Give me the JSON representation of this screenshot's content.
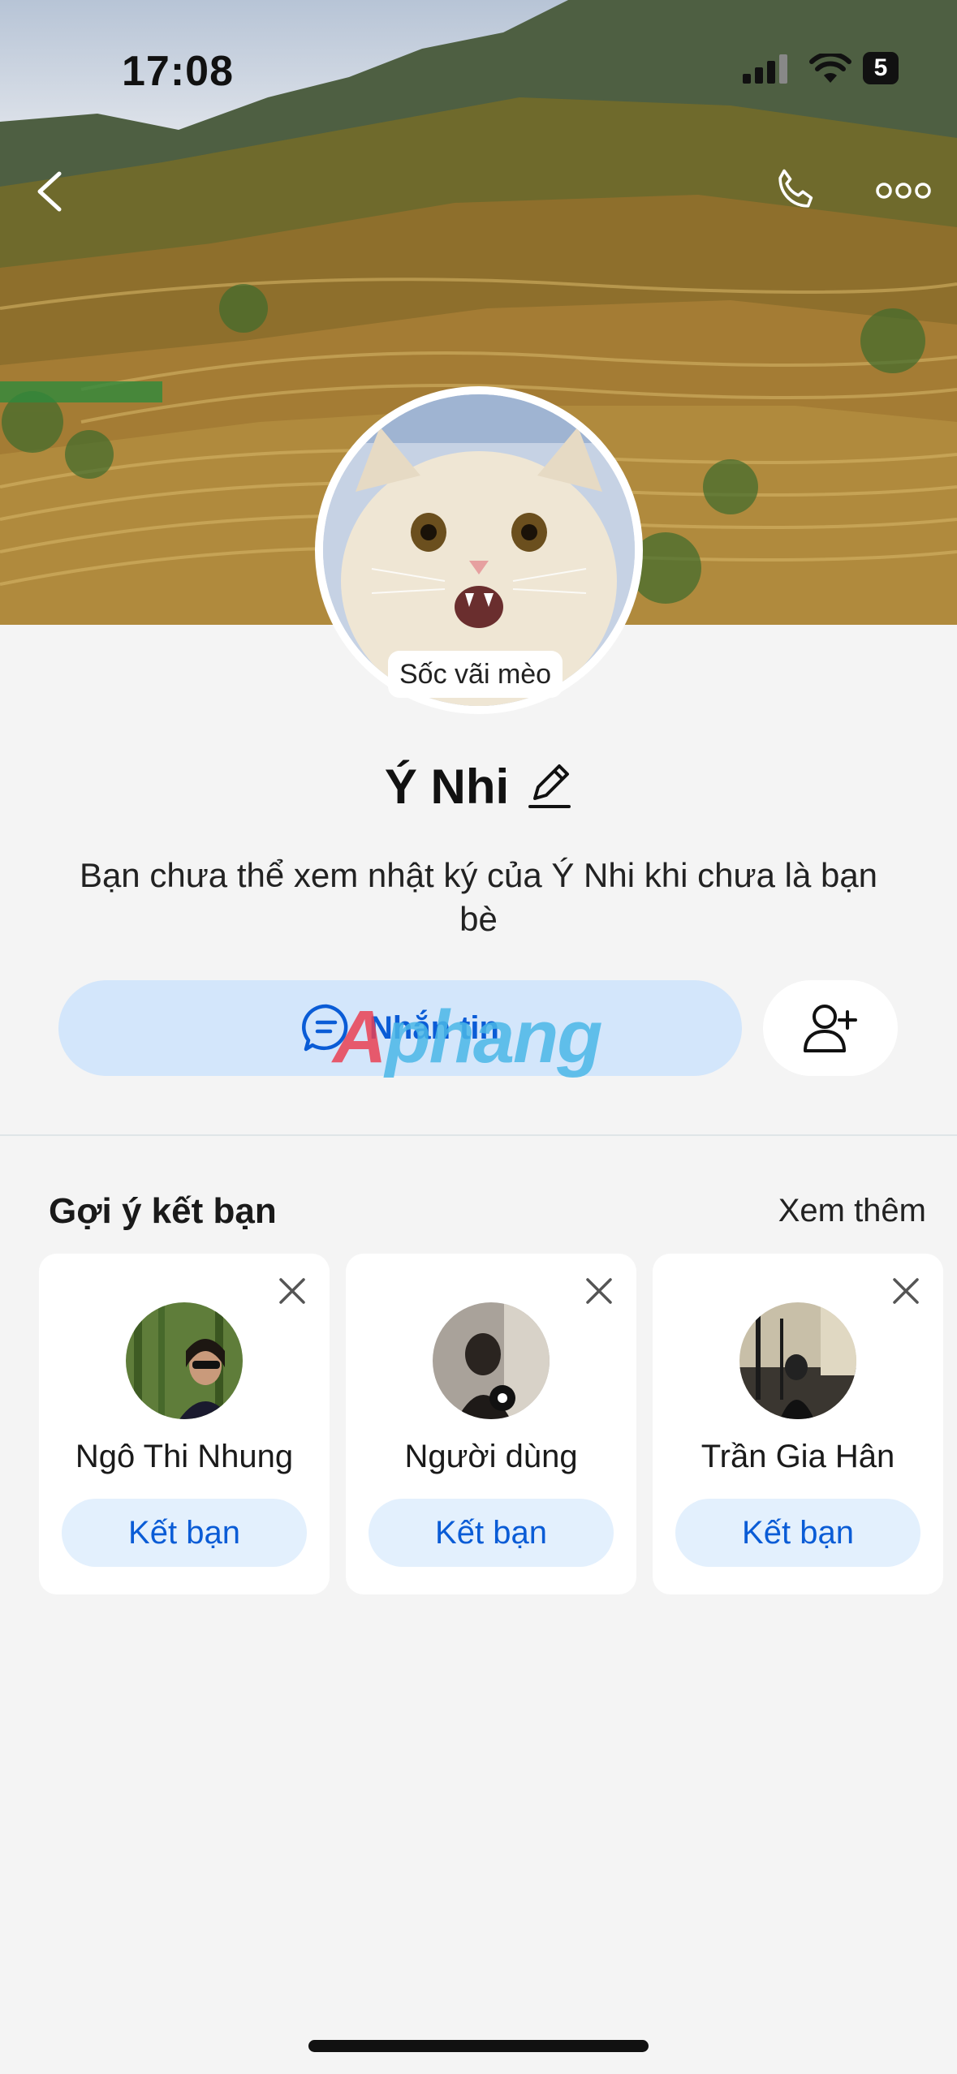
{
  "status_bar": {
    "time": "17:08",
    "battery": "5"
  },
  "profile": {
    "avatar_caption": "Sốc vãi mèo",
    "name": "Ý Nhi",
    "diary_notice": "Bạn chưa thể xem nhật ký của Ý Nhi khi chưa là bạn bè",
    "message_button": "Nhắn tin"
  },
  "watermark": {
    "part1": "A",
    "part2": "phang"
  },
  "suggestions": {
    "title": "Gợi ý kết bạn",
    "see_more": "Xem thêm",
    "items": [
      {
        "name": "Ngô Thi Nhung",
        "action": "Kết bạn"
      },
      {
        "name": "Người dùng",
        "action": "Kết bạn"
      },
      {
        "name": "Trần Gia Hân",
        "action": "Kết bạn"
      }
    ]
  },
  "colors": {
    "accent": "#0a5cd6",
    "button_bg": "#d3e6fb",
    "page_bg": "#f4f4f4"
  }
}
